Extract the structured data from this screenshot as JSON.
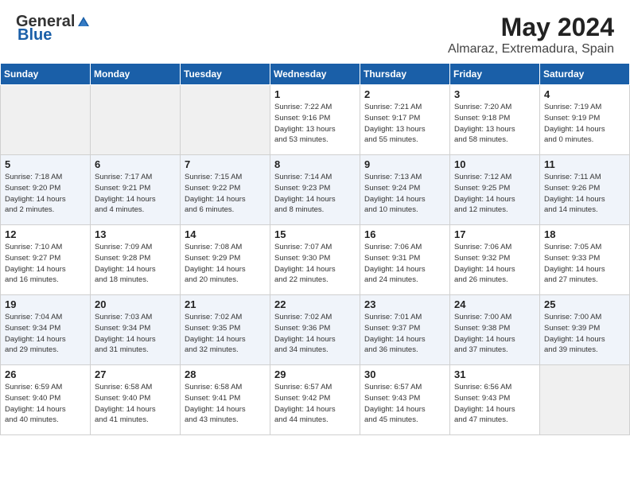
{
  "header": {
    "logo_general": "General",
    "logo_blue": "Blue",
    "title": "May 2024",
    "location": "Almaraz, Extremadura, Spain"
  },
  "days_of_week": [
    "Sunday",
    "Monday",
    "Tuesday",
    "Wednesday",
    "Thursday",
    "Friday",
    "Saturday"
  ],
  "weeks": [
    [
      {
        "day": null,
        "info": null
      },
      {
        "day": null,
        "info": null
      },
      {
        "day": null,
        "info": null
      },
      {
        "day": "1",
        "info": "Sunrise: 7:22 AM\nSunset: 9:16 PM\nDaylight: 13 hours\nand 53 minutes."
      },
      {
        "day": "2",
        "info": "Sunrise: 7:21 AM\nSunset: 9:17 PM\nDaylight: 13 hours\nand 55 minutes."
      },
      {
        "day": "3",
        "info": "Sunrise: 7:20 AM\nSunset: 9:18 PM\nDaylight: 13 hours\nand 58 minutes."
      },
      {
        "day": "4",
        "info": "Sunrise: 7:19 AM\nSunset: 9:19 PM\nDaylight: 14 hours\nand 0 minutes."
      }
    ],
    [
      {
        "day": "5",
        "info": "Sunrise: 7:18 AM\nSunset: 9:20 PM\nDaylight: 14 hours\nand 2 minutes."
      },
      {
        "day": "6",
        "info": "Sunrise: 7:17 AM\nSunset: 9:21 PM\nDaylight: 14 hours\nand 4 minutes."
      },
      {
        "day": "7",
        "info": "Sunrise: 7:15 AM\nSunset: 9:22 PM\nDaylight: 14 hours\nand 6 minutes."
      },
      {
        "day": "8",
        "info": "Sunrise: 7:14 AM\nSunset: 9:23 PM\nDaylight: 14 hours\nand 8 minutes."
      },
      {
        "day": "9",
        "info": "Sunrise: 7:13 AM\nSunset: 9:24 PM\nDaylight: 14 hours\nand 10 minutes."
      },
      {
        "day": "10",
        "info": "Sunrise: 7:12 AM\nSunset: 9:25 PM\nDaylight: 14 hours\nand 12 minutes."
      },
      {
        "day": "11",
        "info": "Sunrise: 7:11 AM\nSunset: 9:26 PM\nDaylight: 14 hours\nand 14 minutes."
      }
    ],
    [
      {
        "day": "12",
        "info": "Sunrise: 7:10 AM\nSunset: 9:27 PM\nDaylight: 14 hours\nand 16 minutes."
      },
      {
        "day": "13",
        "info": "Sunrise: 7:09 AM\nSunset: 9:28 PM\nDaylight: 14 hours\nand 18 minutes."
      },
      {
        "day": "14",
        "info": "Sunrise: 7:08 AM\nSunset: 9:29 PM\nDaylight: 14 hours\nand 20 minutes."
      },
      {
        "day": "15",
        "info": "Sunrise: 7:07 AM\nSunset: 9:30 PM\nDaylight: 14 hours\nand 22 minutes."
      },
      {
        "day": "16",
        "info": "Sunrise: 7:06 AM\nSunset: 9:31 PM\nDaylight: 14 hours\nand 24 minutes."
      },
      {
        "day": "17",
        "info": "Sunrise: 7:06 AM\nSunset: 9:32 PM\nDaylight: 14 hours\nand 26 minutes."
      },
      {
        "day": "18",
        "info": "Sunrise: 7:05 AM\nSunset: 9:33 PM\nDaylight: 14 hours\nand 27 minutes."
      }
    ],
    [
      {
        "day": "19",
        "info": "Sunrise: 7:04 AM\nSunset: 9:34 PM\nDaylight: 14 hours\nand 29 minutes."
      },
      {
        "day": "20",
        "info": "Sunrise: 7:03 AM\nSunset: 9:34 PM\nDaylight: 14 hours\nand 31 minutes."
      },
      {
        "day": "21",
        "info": "Sunrise: 7:02 AM\nSunset: 9:35 PM\nDaylight: 14 hours\nand 32 minutes."
      },
      {
        "day": "22",
        "info": "Sunrise: 7:02 AM\nSunset: 9:36 PM\nDaylight: 14 hours\nand 34 minutes."
      },
      {
        "day": "23",
        "info": "Sunrise: 7:01 AM\nSunset: 9:37 PM\nDaylight: 14 hours\nand 36 minutes."
      },
      {
        "day": "24",
        "info": "Sunrise: 7:00 AM\nSunset: 9:38 PM\nDaylight: 14 hours\nand 37 minutes."
      },
      {
        "day": "25",
        "info": "Sunrise: 7:00 AM\nSunset: 9:39 PM\nDaylight: 14 hours\nand 39 minutes."
      }
    ],
    [
      {
        "day": "26",
        "info": "Sunrise: 6:59 AM\nSunset: 9:40 PM\nDaylight: 14 hours\nand 40 minutes."
      },
      {
        "day": "27",
        "info": "Sunrise: 6:58 AM\nSunset: 9:40 PM\nDaylight: 14 hours\nand 41 minutes."
      },
      {
        "day": "28",
        "info": "Sunrise: 6:58 AM\nSunset: 9:41 PM\nDaylight: 14 hours\nand 43 minutes."
      },
      {
        "day": "29",
        "info": "Sunrise: 6:57 AM\nSunset: 9:42 PM\nDaylight: 14 hours\nand 44 minutes."
      },
      {
        "day": "30",
        "info": "Sunrise: 6:57 AM\nSunset: 9:43 PM\nDaylight: 14 hours\nand 45 minutes."
      },
      {
        "day": "31",
        "info": "Sunrise: 6:56 AM\nSunset: 9:43 PM\nDaylight: 14 hours\nand 47 minutes."
      },
      {
        "day": null,
        "info": null
      }
    ]
  ]
}
